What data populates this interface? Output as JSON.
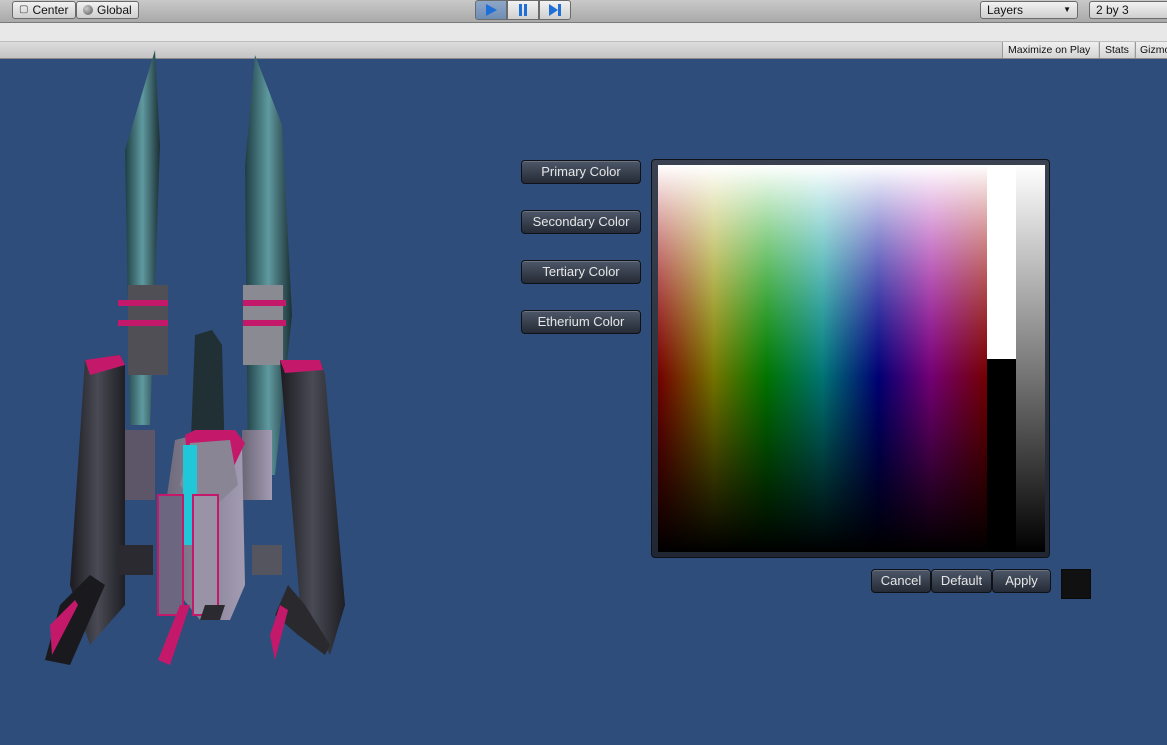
{
  "toolbar": {
    "pivot_label": "Center",
    "space_label": "Global",
    "layers_label": "Layers",
    "layout_label": "2 by 3"
  },
  "game_view": {
    "maximize_label": "Maximize on Play",
    "stats_label": "Stats",
    "gizmos_label": "Gizmos"
  },
  "color_buttons": {
    "primary": "Primary Color",
    "secondary": "Secondary Color",
    "tertiary": "Tertiary Color",
    "etherium": "Etherium Color"
  },
  "picker": {
    "cancel_label": "Cancel",
    "default_label": "Default",
    "apply_label": "Apply",
    "selected_color": "#111111",
    "saturation_level": 0.5
  },
  "colors": {
    "background": "#2e4d7a",
    "play_active": "#1f6fd6",
    "ship_accent_pink": "#c4196b",
    "ship_accent_cyan": "#1fc7d8"
  }
}
